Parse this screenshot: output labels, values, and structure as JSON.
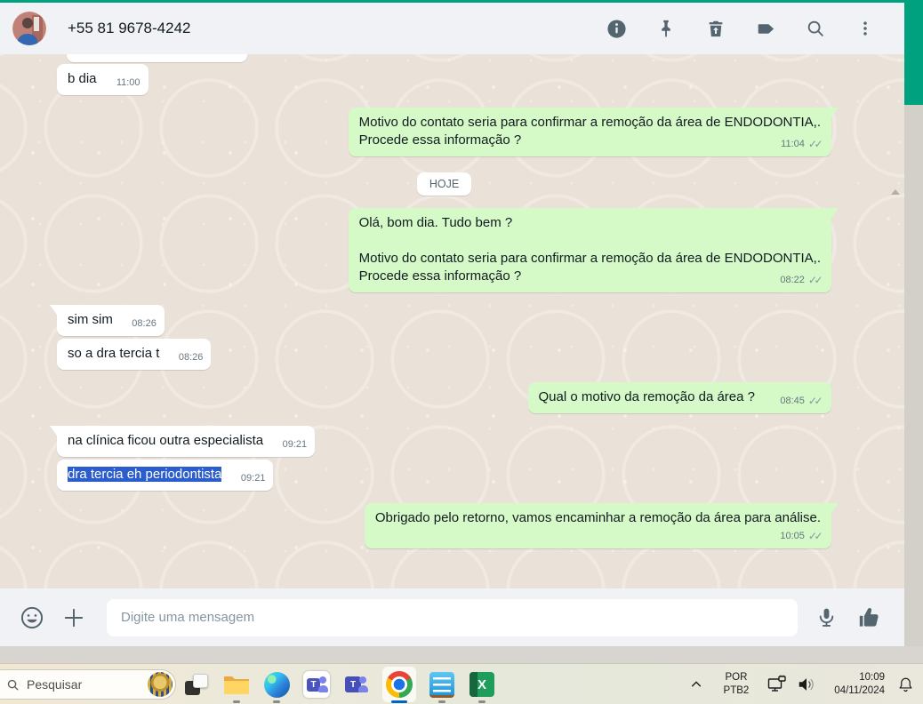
{
  "colors": {
    "accent_green": "#00a17e",
    "outgoing_bubble": "#d5f9c7",
    "incoming_bubble": "#ffffff",
    "selection_blue": "#2b5dcc",
    "chrome_indicator_blue": "#0067c0",
    "header_icon_gray": "#54656f"
  },
  "icons": {
    "header": [
      "info-icon",
      "pin-icon",
      "delete-icon",
      "label-icon",
      "search-icon",
      "menu-kebab-icon"
    ],
    "composer": [
      "emoji-icon",
      "plus-icon",
      "mic-icon",
      "thumbs-up-icon"
    ],
    "taskbar": [
      "search-icon",
      "task-view-icon",
      "file-explorer-icon",
      "edge-icon",
      "teams-light-icon",
      "teams-dark-icon",
      "chrome-icon",
      "notepad-icon",
      "excel-icon"
    ],
    "tray": [
      "chevron-up-icon",
      "network-display-icon",
      "speaker-icon",
      "bell-icon"
    ]
  },
  "header": {
    "title": "+55 81 9678-4242"
  },
  "chat": {
    "messages": [
      {
        "kind": "in",
        "text": "b dia",
        "time": "11:00"
      },
      {
        "kind": "out",
        "text": [
          "Motivo do contato seria para confirmar a remoção da área de ENDODONTIA,.",
          "Procede essa informação ?"
        ],
        "time": "11:04",
        "ticks": true,
        "tail": true
      },
      {
        "kind": "divider",
        "text": "HOJE"
      },
      {
        "kind": "out",
        "text": [
          "Olá, bom dia. Tudo bem ?",
          "",
          "Motivo do contato seria para confirmar a remoção da área de ENDODONTIA,.",
          "Procede essa informação ?"
        ],
        "time": "08:22",
        "ticks": true,
        "tail": true
      },
      {
        "kind": "in",
        "text": "sim sim",
        "time": "08:26",
        "tail": true
      },
      {
        "kind": "in",
        "text": "so a dra tercia t",
        "time": "08:26"
      },
      {
        "kind": "out",
        "text": "Qual o motivo da remoção da área ?",
        "time": "08:45",
        "ticks": true
      },
      {
        "kind": "in",
        "text": "na clínica ficou outra especialista",
        "time": "09:21",
        "tail": true
      },
      {
        "kind": "in",
        "text": "dra tercia eh periodontista",
        "time": "09:21",
        "selected": true
      },
      {
        "kind": "out",
        "text": [
          "Obrigado pelo retorno, vamos encaminhar a remoção da área para análise."
        ],
        "time": "10:05",
        "ticks": true,
        "tail": true,
        "time_row": true
      }
    ]
  },
  "composer": {
    "placeholder": "Digite uma mensagem"
  },
  "taskbar": {
    "search_label": "Pesquisar",
    "tray": {
      "lang_line1": "POR",
      "lang_line2": "PTB2",
      "time": "10:09",
      "date": "04/11/2024"
    }
  }
}
